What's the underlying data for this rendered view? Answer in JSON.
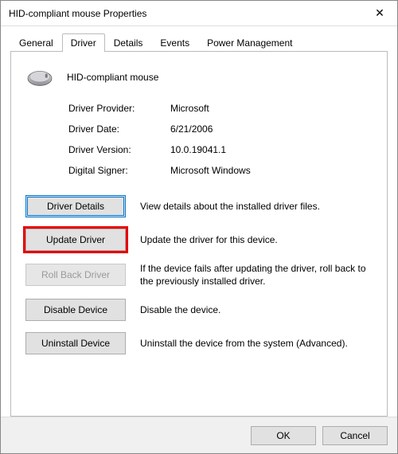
{
  "window": {
    "title": "HID-compliant mouse Properties"
  },
  "tabs": [
    {
      "label": "General"
    },
    {
      "label": "Driver"
    },
    {
      "label": "Details"
    },
    {
      "label": "Events"
    },
    {
      "label": "Power Management"
    }
  ],
  "active_tab": "Driver",
  "device_name": "HID-compliant mouse",
  "info": {
    "provider_label": "Driver Provider:",
    "provider_value": "Microsoft",
    "date_label": "Driver Date:",
    "date_value": "6/21/2006",
    "version_label": "Driver Version:",
    "version_value": "10.0.19041.1",
    "signer_label": "Digital Signer:",
    "signer_value": "Microsoft Windows"
  },
  "actions": {
    "details_label": "Driver Details",
    "details_desc": "View details about the installed driver files.",
    "update_label": "Update Driver",
    "update_desc": "Update the driver for this device.",
    "rollback_label": "Roll Back Driver",
    "rollback_desc": "If the device fails after updating the driver, roll back to the previously installed driver.",
    "disable_label": "Disable Device",
    "disable_desc": "Disable the device.",
    "uninstall_label": "Uninstall Device",
    "uninstall_desc": "Uninstall the device from the system (Advanced)."
  },
  "footer": {
    "ok": "OK",
    "cancel": "Cancel"
  }
}
